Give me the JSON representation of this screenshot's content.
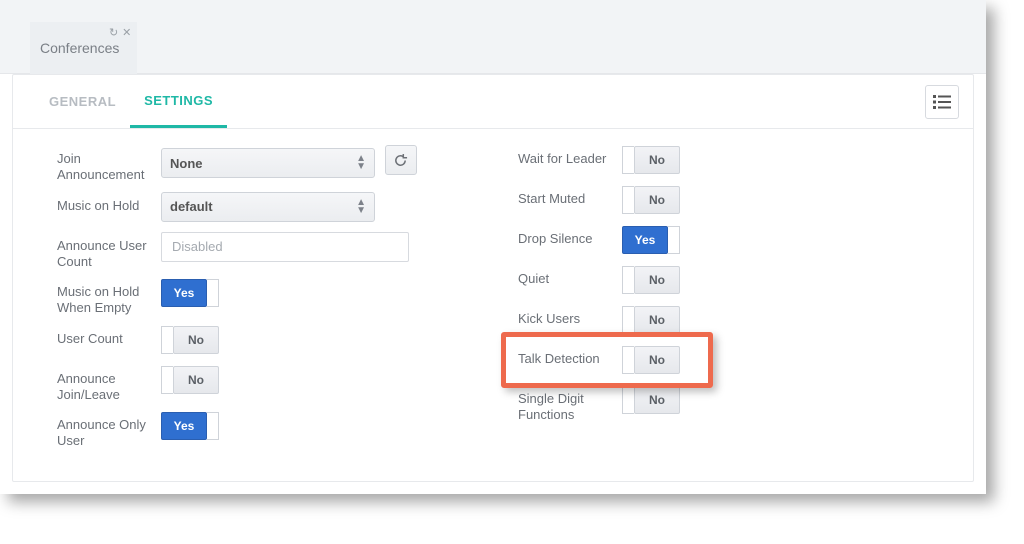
{
  "window": {
    "title": "Conferences"
  },
  "tabs": {
    "general": "GENERAL",
    "settings": "SETTINGS",
    "active": "settings"
  },
  "left": {
    "join_announcement": {
      "label": "Join Announcement",
      "value": "None"
    },
    "music_on_hold": {
      "label": "Music on Hold",
      "value": "default"
    },
    "announce_user_count": {
      "label": "Announce User Count",
      "value": "Disabled"
    },
    "moh_when_empty": {
      "label": "Music on Hold When Empty",
      "state": true,
      "text": "Yes"
    },
    "user_count": {
      "label": "User Count",
      "state": false,
      "text": "No"
    },
    "announce_join_leave": {
      "label": "Announce Join/Leave",
      "state": false,
      "text": "No"
    },
    "announce_only_user": {
      "label": "Announce Only User",
      "state": true,
      "text": "Yes"
    }
  },
  "right": {
    "wait_for_leader": {
      "label": "Wait for Leader",
      "state": false,
      "text": "No"
    },
    "start_muted": {
      "label": "Start Muted",
      "state": false,
      "text": "No"
    },
    "drop_silence": {
      "label": "Drop Silence",
      "state": true,
      "text": "Yes"
    },
    "quiet": {
      "label": "Quiet",
      "state": false,
      "text": "No"
    },
    "kick_users": {
      "label": "Kick Users",
      "state": false,
      "text": "No"
    },
    "talk_detection": {
      "label": "Talk Detection",
      "state": false,
      "text": "No"
    },
    "single_digit_functions": {
      "label": "Single Digit Functions",
      "state": false,
      "text": "No"
    }
  }
}
